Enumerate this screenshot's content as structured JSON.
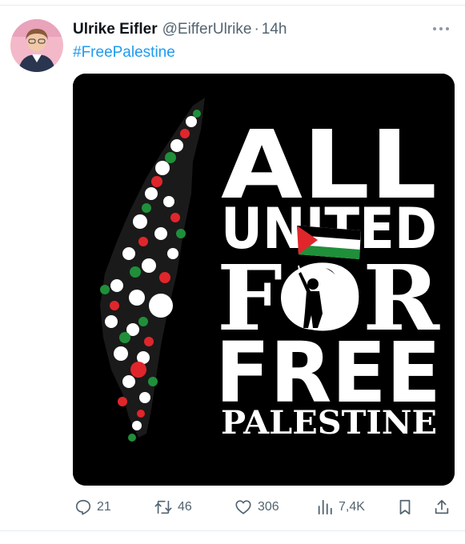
{
  "author": {
    "display_name": "Ulrike Eifler",
    "handle": "@EifferUlrike",
    "separator": "·",
    "time": "14h"
  },
  "tweet": {
    "text": "#FreePalestine"
  },
  "media": {
    "line1": "ALL",
    "line2": "UNITED",
    "line3": "FOR",
    "line4": "FREE",
    "line5": "PALESTINE"
  },
  "actions": {
    "replies": "21",
    "retweets": "46",
    "likes": "306",
    "views": "7,4K"
  },
  "icons": {
    "more": "more-horizontal-icon",
    "reply": "reply-icon",
    "retweet": "retweet-icon",
    "like": "heart-icon",
    "views": "views-chart-icon",
    "bookmark": "bookmark-icon",
    "share": "share-icon"
  },
  "colors": {
    "link": "#1d9bf0",
    "muted": "#536471",
    "flag_red": "#e0262b",
    "flag_green": "#1f8f3a"
  }
}
